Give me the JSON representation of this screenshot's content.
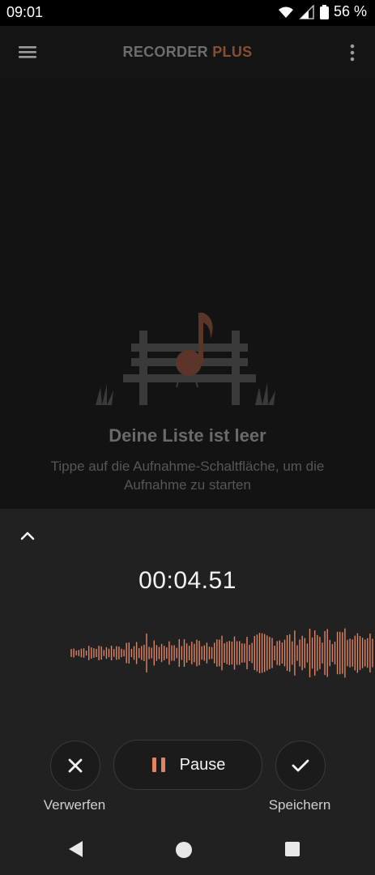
{
  "status_bar": {
    "time": "09:01",
    "battery": "56 %",
    "icons": [
      "wifi-icon",
      "signal-icon",
      "battery-icon"
    ]
  },
  "app_bar": {
    "title_main": "RECORDER",
    "title_accent": "PLUS",
    "icons": [
      "menu-icon",
      "more-vert-icon"
    ]
  },
  "empty_state": {
    "title": "Deine Liste ist leer",
    "subtitle": "Tippe auf die Aufnahme-Schaltfläche, um die Aufnahme zu starten",
    "illustration": "bench-with-music-note"
  },
  "recording_sheet": {
    "timer": "00:04.51",
    "collapse_icon": "chevron-up-icon",
    "discard_label": "Verwerfen",
    "pause_label": "Pause",
    "save_label": "Speichern"
  },
  "colors": {
    "accent": "#e08466",
    "brand_dim": "#8a4d34",
    "background": "#131313",
    "sheet": "#212121"
  },
  "nav_bar": {
    "icons": [
      "back-icon",
      "home-icon",
      "recents-icon"
    ]
  }
}
